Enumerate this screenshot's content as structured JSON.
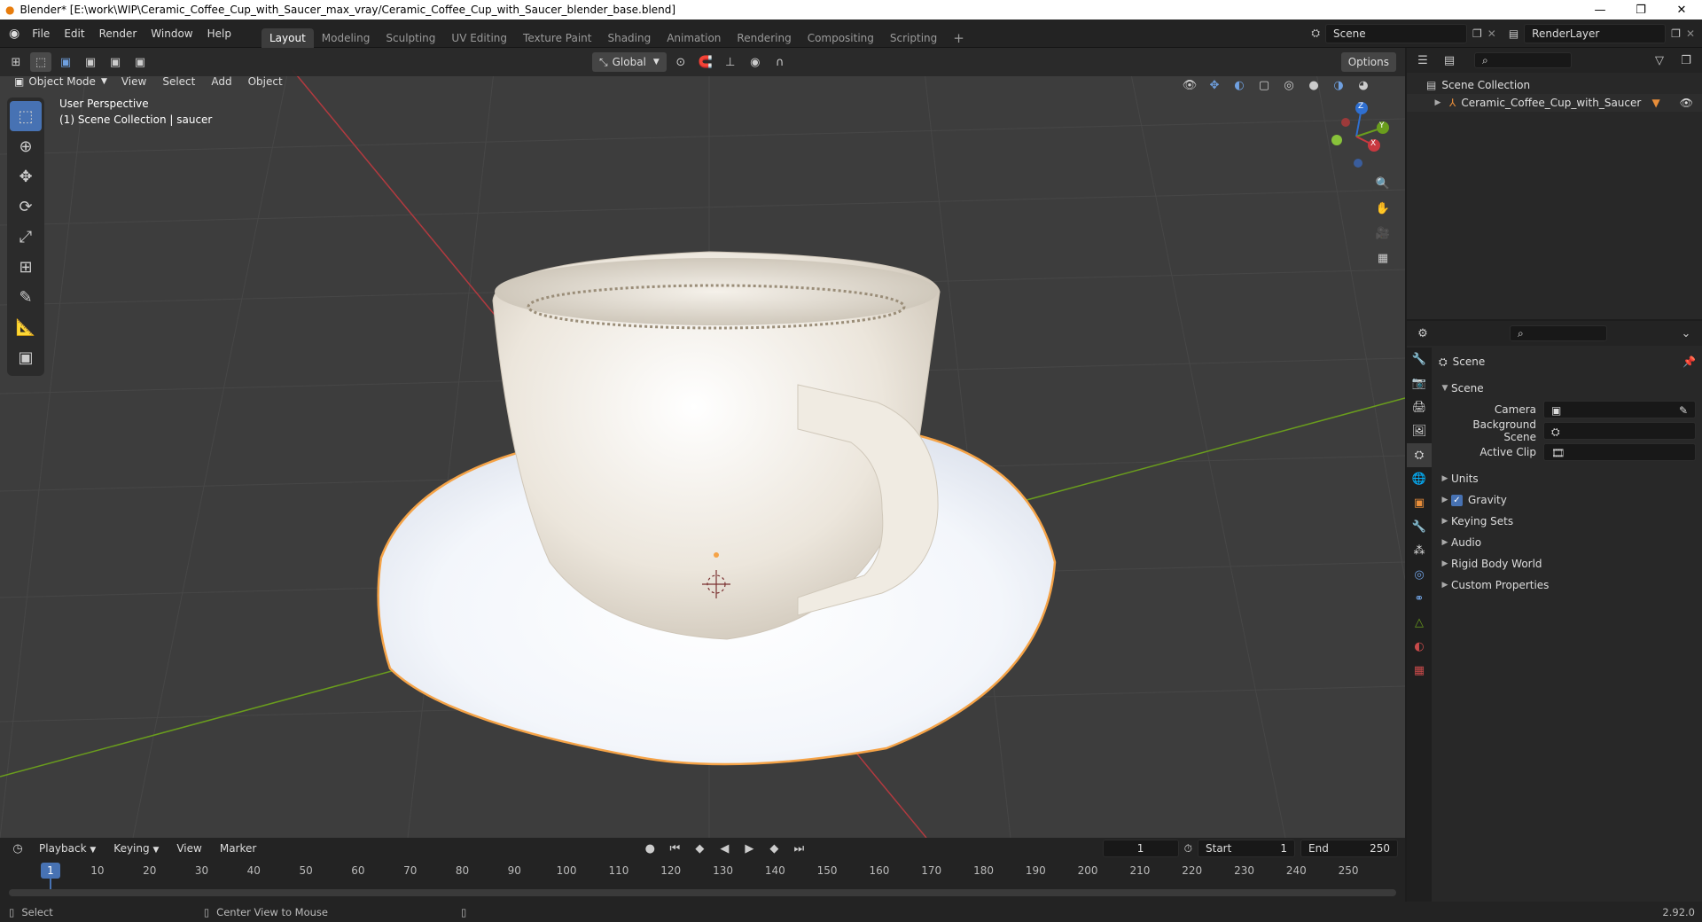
{
  "window": {
    "title": "Blender* [E:\\work\\WIP\\Ceramic_Coffee_Cup_with_Saucer_max_vray/Ceramic_Coffee_Cup_with_Saucer_blender_base.blend]",
    "minimize": "—",
    "restore": "❐",
    "close": "✕"
  },
  "menu": {
    "file": "File",
    "edit": "Edit",
    "render": "Render",
    "window": "Window",
    "help": "Help"
  },
  "workspaces": [
    "Layout",
    "Modeling",
    "Sculpting",
    "UV Editing",
    "Texture Paint",
    "Shading",
    "Animation",
    "Rendering",
    "Compositing",
    "Scripting"
  ],
  "scene_field": "Scene",
  "renderlayer_field": "RenderLayer",
  "viewport": {
    "transform_orientation": "Global",
    "options": "Options",
    "mode": "Object Mode",
    "view": "View",
    "select": "Select",
    "add": "Add",
    "object": "Object",
    "perspective": "User Perspective",
    "collection_info": "(1) Scene Collection | saucer",
    "gizmo": {
      "x": "X",
      "y": "Y",
      "z": "Z"
    }
  },
  "outliner": {
    "root": "Scene Collection",
    "items": [
      {
        "label": "Ceramic_Coffee_Cup_with_Saucer"
      }
    ]
  },
  "properties": {
    "header": "Scene",
    "section": "Scene",
    "fields": [
      {
        "label": "Camera"
      },
      {
        "label": "Background Scene"
      },
      {
        "label": "Active Clip"
      }
    ],
    "panels": [
      {
        "label": "Units",
        "checkbox": false
      },
      {
        "label": "Gravity",
        "checkbox": true
      },
      {
        "label": "Keying Sets",
        "checkbox": false
      },
      {
        "label": "Audio",
        "checkbox": false
      },
      {
        "label": "Rigid Body World",
        "checkbox": false
      },
      {
        "label": "Custom Properties",
        "checkbox": false
      }
    ]
  },
  "timeline": {
    "playback": "Playback",
    "keying": "Keying",
    "view": "View",
    "marker": "Marker",
    "current_frame": "1",
    "start_label": "Start",
    "start": "1",
    "end_label": "End",
    "end": "250",
    "ticks": [
      "1",
      "10",
      "20",
      "30",
      "40",
      "50",
      "60",
      "70",
      "80",
      "90",
      "100",
      "110",
      "120",
      "130",
      "140",
      "150",
      "160",
      "170",
      "180",
      "190",
      "200",
      "210",
      "220",
      "230",
      "240",
      "250"
    ]
  },
  "status": {
    "select": "Select",
    "center_view": "Center View to Mouse",
    "version": "2.92.0"
  },
  "colors": {
    "accent": "#4772b3",
    "selection": "#f5a347",
    "x_axis": "#c8383f",
    "y_axis": "#6a9d1d"
  }
}
